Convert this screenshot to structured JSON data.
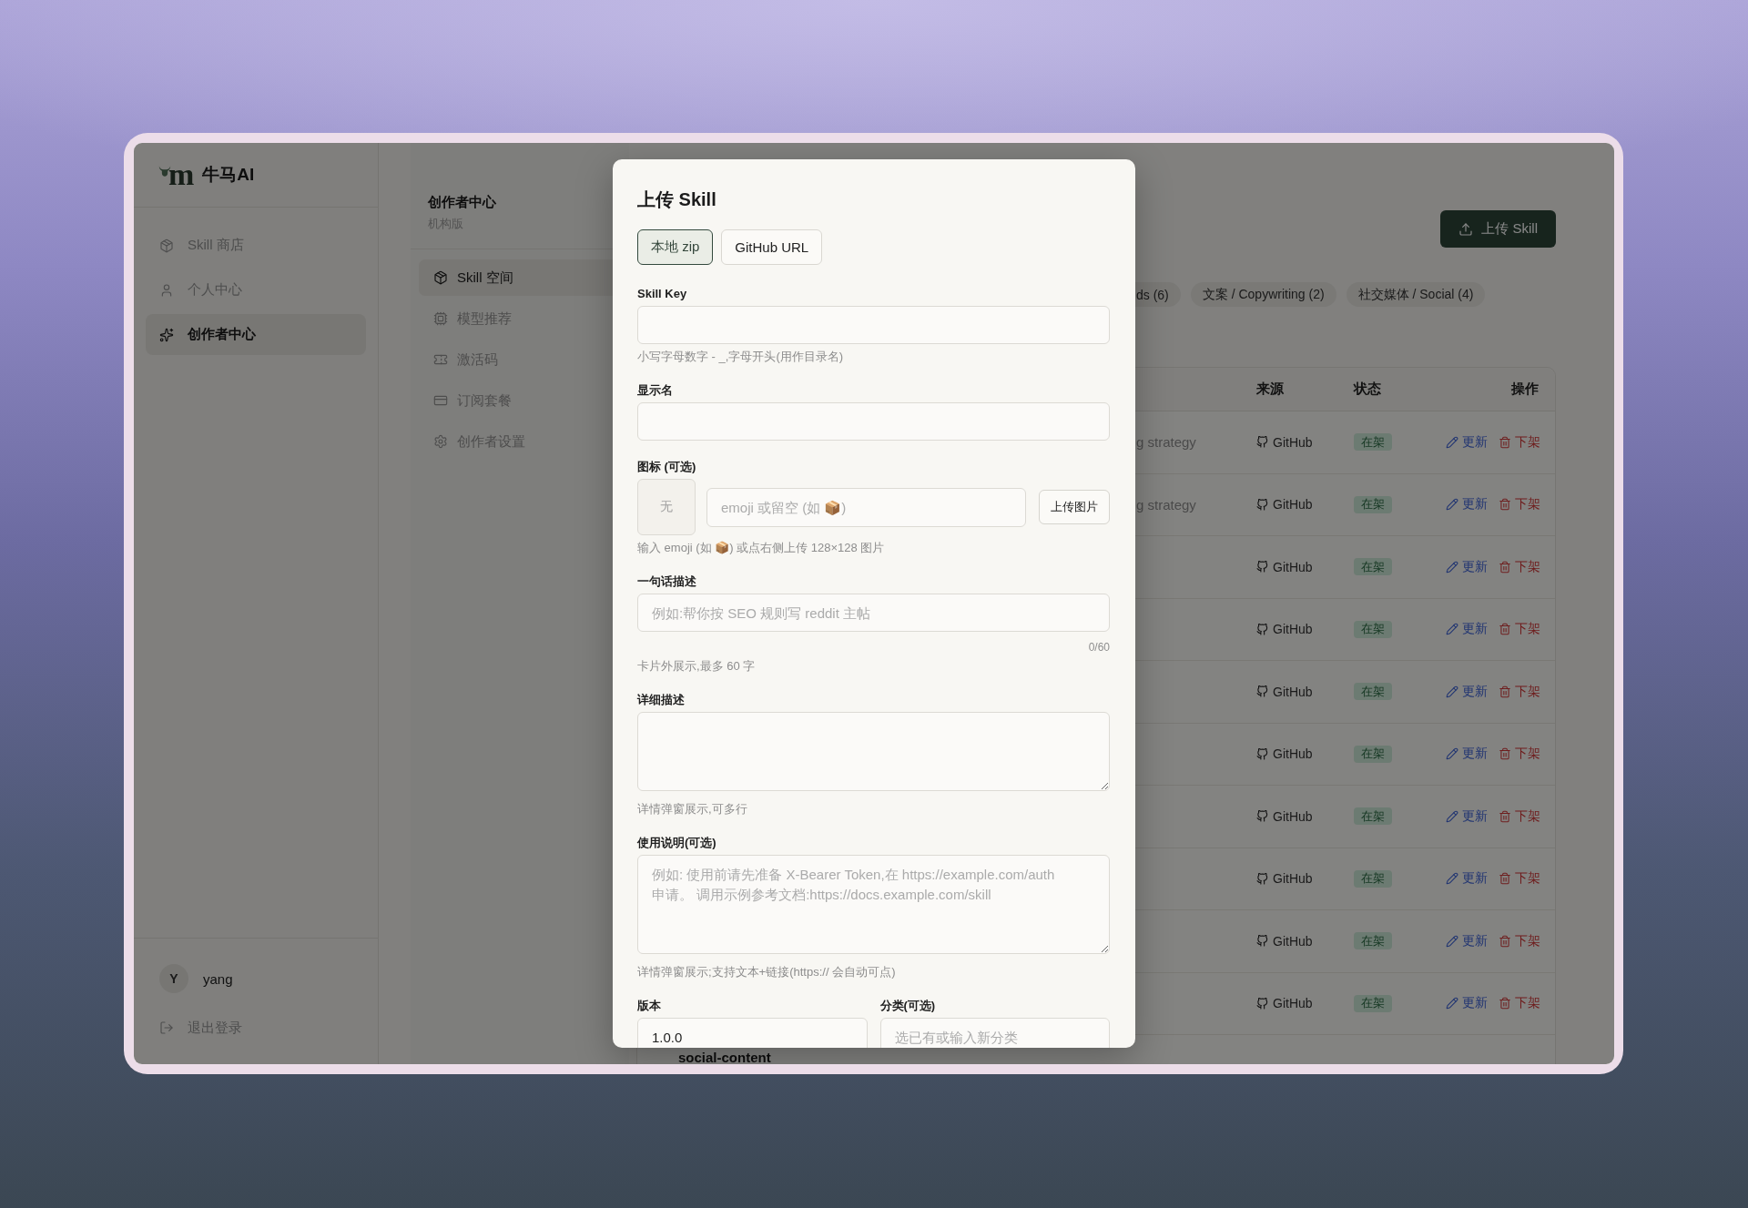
{
  "sidebar": {
    "logo_letter": "m",
    "brand": "牛马AI",
    "items": [
      {
        "label": "Skill 商店",
        "selected": false
      },
      {
        "label": "个人中心",
        "selected": false
      },
      {
        "label": "创作者中心",
        "selected": true
      }
    ],
    "user": {
      "initial": "Y",
      "name": "yang"
    },
    "logout": "退出登录"
  },
  "subnav": {
    "title": "创作者中心",
    "subtitle": "机构版",
    "items": [
      {
        "label": "Skill 空间",
        "selected": true
      },
      {
        "label": "模型推荐",
        "selected": false
      },
      {
        "label": "激活码",
        "selected": false
      },
      {
        "label": "订阅套餐",
        "selected": false
      },
      {
        "label": "创作者设置",
        "selected": false
      }
    ]
  },
  "main": {
    "upload_button": "上传 Skill",
    "filter_chips": [
      {
        "label": "ds (6)",
        "selected": false,
        "clipped_left": true
      },
      {
        "label": "文案 / Copywriting (2)",
        "selected": false,
        "clipped_left": false
      },
      {
        "label": "社交媒体 / Social (4)",
        "selected": false,
        "clipped_left": false
      }
    ],
    "table": {
      "columns": [
        "来源",
        "状态",
        "操作"
      ],
      "rows": [
        {
          "column_3": "g strategy",
          "column_3_clipped": true,
          "source": "GitHub",
          "status": "在架",
          "actions": [
            {
              "label": "更新",
              "kind": "edit"
            },
            {
              "label": "下架",
              "kind": "remove"
            }
          ]
        },
        {
          "column_3": "g strategy",
          "column_3_clipped": true,
          "source": "GitHub",
          "status": "在架",
          "actions": [
            {
              "label": "更新",
              "kind": "edit"
            },
            {
              "label": "下架",
              "kind": "remove"
            }
          ]
        },
        {
          "source": "GitHub",
          "status": "在架",
          "actions": [
            {
              "label": "更新",
              "kind": "edit"
            },
            {
              "label": "下架",
              "kind": "remove"
            }
          ]
        },
        {
          "source": "GitHub",
          "status": "在架",
          "actions": [
            {
              "label": "更新",
              "kind": "edit"
            },
            {
              "label": "下架",
              "kind": "remove"
            }
          ]
        },
        {
          "source": "GitHub",
          "status": "在架",
          "actions": [
            {
              "label": "更新",
              "kind": "edit"
            },
            {
              "label": "下架",
              "kind": "remove"
            }
          ]
        },
        {
          "source": "GitHub",
          "status": "在架",
          "actions": [
            {
              "label": "更新",
              "kind": "edit"
            },
            {
              "label": "下架",
              "kind": "remove"
            }
          ]
        },
        {
          "source": "GitHub",
          "status": "在架",
          "actions": [
            {
              "label": "更新",
              "kind": "edit"
            },
            {
              "label": "下架",
              "kind": "remove"
            }
          ]
        },
        {
          "source": "GitHub",
          "status": "在架",
          "actions": [
            {
              "label": "更新",
              "kind": "edit"
            },
            {
              "label": "下架",
              "kind": "remove"
            }
          ]
        },
        {
          "source": "GitHub",
          "status": "在架",
          "actions": [
            {
              "label": "更新",
              "kind": "edit"
            },
            {
              "label": "下架",
              "kind": "remove"
            }
          ]
        },
        {
          "source": "GitHub",
          "status": "在架",
          "actions": [
            {
              "label": "更新",
              "kind": "edit"
            },
            {
              "label": "下架",
              "kind": "remove"
            }
          ]
        },
        {
          "column_1": "social-content"
        }
      ]
    }
  },
  "dialog": {
    "title": "上传 Skill",
    "tabs": [
      {
        "label": "本地 zip",
        "selected": true
      },
      {
        "label": "GitHub URL",
        "selected": false
      }
    ],
    "fields": [
      {
        "kind": "input",
        "label": "Skill Key",
        "hint": "小写字母数字 - _,字母开头(用作目录名)"
      },
      {
        "kind": "input",
        "label": "显示名"
      },
      {
        "kind": "icon",
        "label": "图标 (可选)",
        "preview": "无",
        "placeholder": "emoji 或留空 (如 📦)",
        "button": "上传图片",
        "hint": "输入 emoji (如 📦) 或点右侧上传 128×128 图片"
      },
      {
        "kind": "input",
        "label": "一句话描述",
        "placeholder": "例如:帮你按 SEO 规则写 reddit 主帖",
        "counter": "0/60",
        "hint": "卡片外展示,最多 60 字"
      },
      {
        "kind": "textarea",
        "label": "详细描述",
        "hint": "详情弹窗展示,可多行"
      },
      {
        "kind": "textarea",
        "label": "使用说明(可选)",
        "placeholder": "例如: 使用前请先准备 X-Bearer Token,在 https://example.com/auth\n申请。 调用示例参考文档:https://docs.example.com/skill",
        "hint": "详情弹窗展示;支持文本+链接(https:// 会自动可点)"
      },
      {
        "kind": "pair",
        "columns": [
          {
            "label": "版本",
            "value": "1.0.0"
          },
          {
            "label": "分类(可选)",
            "placeholder": "选已有或输入新分类"
          }
        ]
      }
    ]
  }
}
